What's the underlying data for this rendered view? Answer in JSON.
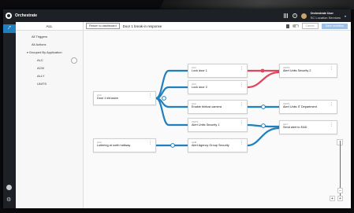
{
  "app": {
    "title": "Orchestrate"
  },
  "user": {
    "name": "Orchestrate User",
    "org": "SC Location Services"
  },
  "panel": {
    "header": "ALL",
    "items": [
      {
        "label": "All Triggers"
      },
      {
        "label": "All Actions"
      },
      {
        "label": "Grouped By Application"
      },
      {
        "label": "ALC"
      },
      {
        "label": "ACM"
      },
      {
        "label": "ALLY"
      },
      {
        "label": "UNITS"
      }
    ]
  },
  "canvas_header": {
    "back_label": "Return to dashboard",
    "flow_title": "Door 1 break-in response",
    "cancel_label": "Cancel",
    "save_label": "Save workflow"
  },
  "nodes": [
    {
      "type": "ACC",
      "label": "Door 1 intrusion"
    },
    {
      "type": "ACC",
      "label": "Lock door 1"
    },
    {
      "type": "ACC",
      "label": "Lock door 2"
    },
    {
      "type": "ACC",
      "label": "Enable thirtust camera"
    },
    {
      "type": "UNITS",
      "label": "Alert Units Security 1"
    },
    {
      "type": "UNITS",
      "label": "Alert Units Security 2"
    },
    {
      "type": "UNITS",
      "label": "Alert Units IT Department"
    },
    {
      "type": "ALLY",
      "label": "Send alert to EAD"
    },
    {
      "type": "ACC",
      "label": "Loitering at north hallway"
    },
    {
      "type": "ACM",
      "label": "Alert Agency Group Security"
    }
  ],
  "colors": {
    "accent": "#1f7fbf",
    "danger": "#e0455e",
    "topbar": "#1d2125"
  }
}
